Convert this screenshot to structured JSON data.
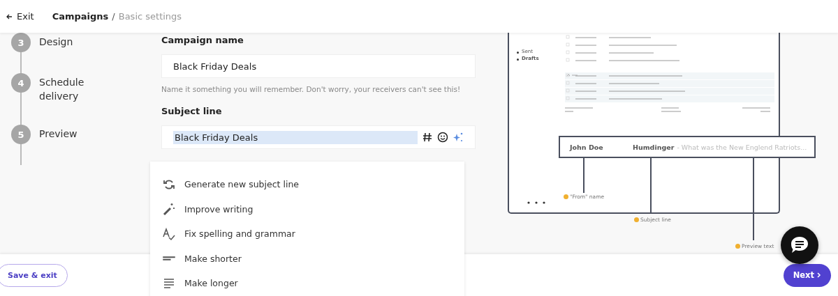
{
  "header": {
    "exit": "Exit",
    "breadcrumb": "Campaigns",
    "breadcrumb_separator": "/",
    "breadcrumb_current": "Basic settings"
  },
  "steps": [
    {
      "number": "3",
      "label": "Design"
    },
    {
      "number": "4",
      "label": "Schedule delivery"
    },
    {
      "number": "5",
      "label": "Preview"
    }
  ],
  "form": {
    "campaign_name_label": "Campaign name",
    "campaign_name_value": "Black Friday Deals",
    "campaign_name_hint": "Name it something you will remember. Don't worry, your receivers can't see this!",
    "subject_label": "Subject line",
    "subject_value": "Black Friday Deals"
  },
  "ai_menu": [
    {
      "kind": "regenerate",
      "label": "Generate new subject line"
    },
    {
      "kind": "improve",
      "label": "Improve writing"
    },
    {
      "kind": "spelling",
      "label": "Fix spelling and grammar"
    },
    {
      "kind": "shorter",
      "label": "Make shorter"
    },
    {
      "kind": "longer",
      "label": "Make longer"
    }
  ],
  "preview": {
    "folders": [
      "Sent",
      "Drafts"
    ],
    "from_name": "John Doe",
    "subject": "Humdinger",
    "preview_text": "- What was the New Englend Ratriots...",
    "callouts": [
      "\"From\" name",
      "Subject line",
      "Preview text"
    ]
  },
  "footer": {
    "save": "Save & exit",
    "next": "Next"
  }
}
